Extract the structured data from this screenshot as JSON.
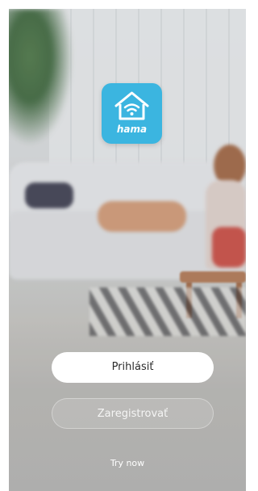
{
  "logo": {
    "brand_text": "hama",
    "icon": "smart-home-wifi-icon",
    "background_color": "#3bb5e0"
  },
  "buttons": {
    "login_label": "Prihlásiť",
    "register_label": "Zaregistrovať",
    "try_now_label": "Try now"
  }
}
